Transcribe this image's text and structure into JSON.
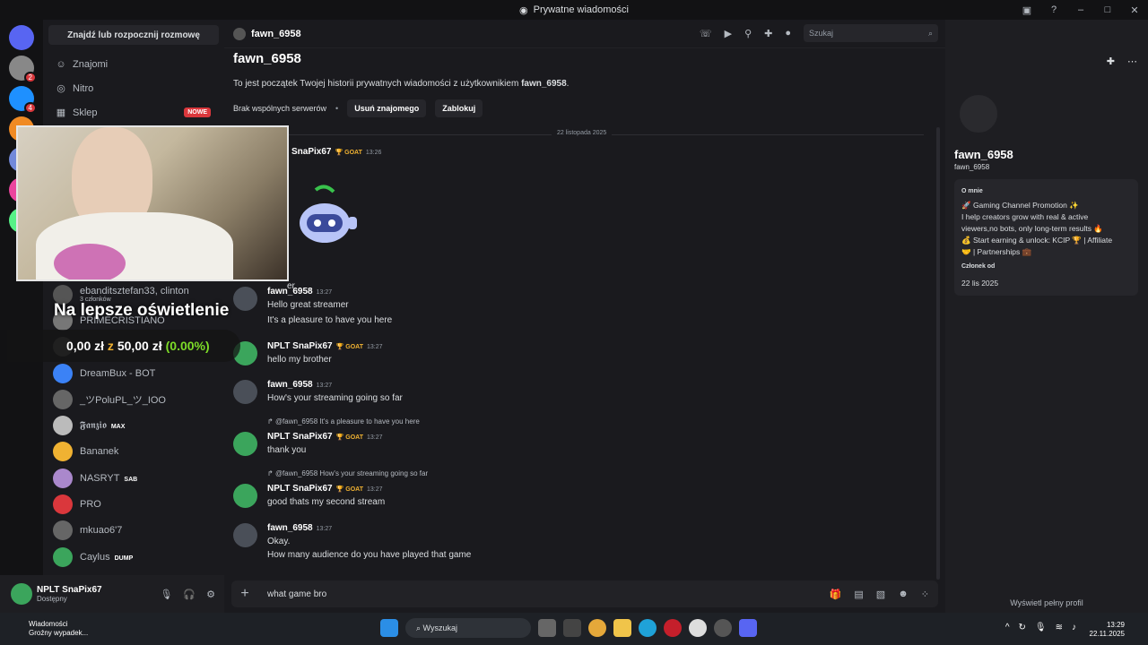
{
  "window": {
    "title": "Prywatne wiadomości"
  },
  "servers": [
    {
      "name": "discord-home",
      "color": "#5865f2",
      "badge": ""
    },
    {
      "name": "server-1",
      "color": "#888888",
      "badge": "2"
    },
    {
      "name": "server-2",
      "color": "#1e90ff",
      "badge": "4"
    },
    {
      "name": "server-3",
      "color": "#f08a24",
      "badge": ""
    },
    {
      "name": "server-4",
      "color": "#7289da",
      "badge": ""
    },
    {
      "name": "server-5",
      "color": "#eb459e",
      "badge": ""
    },
    {
      "name": "server-6",
      "color": "#57f287",
      "badge": ""
    }
  ],
  "dmlist": {
    "search": "Znajdź lub rozpocznij rozmowę",
    "nav": [
      {
        "label": "Znajomi",
        "icon": "friends-icon"
      },
      {
        "label": "Nitro",
        "icon": "nitro-icon"
      },
      {
        "label": "Sklep",
        "icon": "shop-icon",
        "badge": "NOWE"
      }
    ],
    "rows": [
      {
        "name": "ebanditsztefan33, clinton",
        "sub": "3 członków",
        "color": "#555555",
        "tag": ""
      },
      {
        "name": "PRIMECRISTIANO",
        "color": "#777777",
        "tag": ""
      },
      {
        "name": "",
        "color": "#444444",
        "tag": ""
      },
      {
        "name": "DreamBux - BOT",
        "color": "#3b82f6",
        "tag": ""
      },
      {
        "name": "_ツPoluPL_ツ_IOO",
        "color": "#666666",
        "tag": ""
      },
      {
        "name": "𝕱𝖆𝖓𝖟𝖎𝖔",
        "color": "#bbbbbb",
        "tag": "MAX"
      },
      {
        "name": "Bananek",
        "color": "#f0b232",
        "tag": ""
      },
      {
        "name": "NASRYT",
        "color": "#aa88cc",
        "tag": "SAB"
      },
      {
        "name": "PRO",
        "color": "#da373c",
        "tag": ""
      },
      {
        "name": "mkuao6'7",
        "color": "#666666",
        "tag": ""
      },
      {
        "name": "Caylus",
        "color": "#3ba55c",
        "tag": "DUMP"
      }
    ]
  },
  "user": {
    "name": "NPLT SnaPix67",
    "status": "Dostępny"
  },
  "chat": {
    "header_name": "fawn_6958",
    "search_placeholder": "Szukaj",
    "intro_title": "fawn_6958",
    "intro_text_pre": "To jest początek Twojej historii prywatnych wiadomości z użytkownikiem ",
    "intro_user": "fawn_6958",
    "intro_text_post": ".",
    "no_servers": "Brak wspólnych serwerów",
    "remove_friend": "Usuń znajomego",
    "block": "Zablokuj",
    "date_divider": "22 listopada 2025",
    "composer_text": "what game bro"
  },
  "messages": [
    {
      "author": "SnaPix67",
      "goat": "GOAT",
      "time": "13:26",
      "lines": [],
      "partial": "er"
    },
    {
      "author": "fawn_6958",
      "time": "13:27",
      "lines": [
        "Hello great streamer",
        "It's a pleasure to have you here"
      ]
    },
    {
      "author": "NPLT SnaPix67",
      "goat": "GOAT",
      "time": "13:27",
      "lines": [
        "hello my brother"
      ]
    },
    {
      "author": "fawn_6958",
      "time": "13:27",
      "lines": [
        "How's your streaming going so far"
      ]
    },
    {
      "author": "NPLT SnaPix67",
      "goat": "GOAT",
      "time": "13:27",
      "reply": "@fawn_6958 It's a pleasure to have you here",
      "lines": [
        "thank you"
      ]
    },
    {
      "author": "NPLT SnaPix67",
      "goat": "GOAT",
      "time": "13:27",
      "reply": "@fawn_6958 How's your streaming going so far",
      "lines": [
        "good thats my second stream"
      ]
    },
    {
      "author": "fawn_6958",
      "time": "13:27",
      "lines": [
        "Okay.",
        "How many audience do you have played that game"
      ]
    }
  ],
  "profile": {
    "name": "fawn_6958",
    "handle": "fawn_6958",
    "about_label": "O mnie",
    "bio": [
      "🚀 Gaming Channel Promotion ✨",
      "I help creators grow with real & active",
      "viewers,no bots, only long-term results 🔥",
      "💰 Start earning & unlock: KCIP 🏆 | Affiliate",
      "🤝 | Partnerships 💼"
    ],
    "member_since_label": "Członek od",
    "member_since": "22 lis 2025",
    "full_profile": "Wyświetl pełny profil"
  },
  "overlay": {
    "title": "Na lepsze oświetlenie",
    "goal_current": "0,00 zł",
    "goal_z": "z",
    "goal_target": "50,00 zł",
    "goal_pct": "(0.00%)"
  },
  "taskbar": {
    "weather_title": "Wiadomości",
    "weather_sub": "Groźny wypadek...",
    "search": "Wyszukaj",
    "time": "13:29",
    "date": "22.11.2025"
  }
}
